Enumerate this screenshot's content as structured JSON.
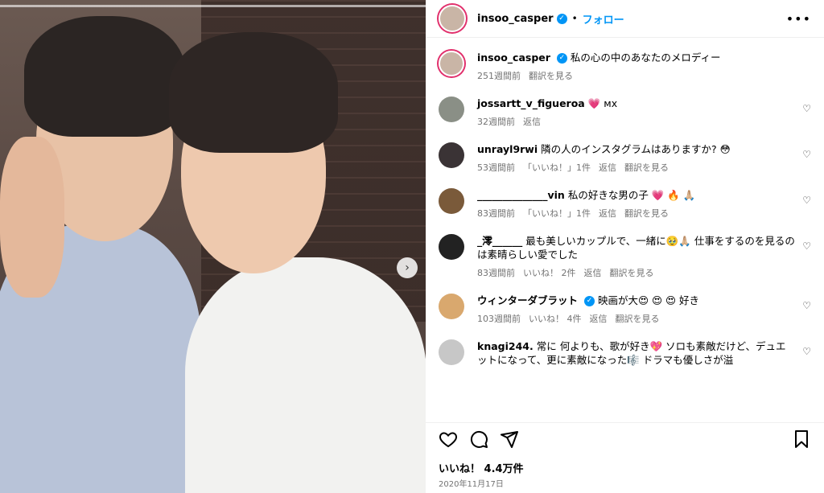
{
  "post": {
    "username": "insoo_casper",
    "follow_label": "フォロー",
    "more_label": "•••",
    "caption": "私の心の中のあなたのメロディー",
    "caption_time": "251週間前",
    "caption_translate": "翻訳を見る",
    "likes": "いいね！ 4.4万件",
    "date": "2020年11月17日"
  },
  "comments": [
    {
      "user": "jossartt_v_figueroa",
      "text": "💗 ᴍx",
      "time": "32週間前",
      "likes": "",
      "reply": "返信",
      "translate": "",
      "avatar_color": "#8a8f86",
      "verified": false
    },
    {
      "user": "unrayl9rwi",
      "text": "隣の人のインスタグラムはありますか? 😳",
      "time": "53週間前",
      "likes": "「いいね！」1件",
      "reply": "返信",
      "translate": "翻訳を見る",
      "avatar_color": "#3a3335",
      "verified": false
    },
    {
      "user": "______________vin",
      "text": "私の好きな男の子 💗 🔥 🙏🏼",
      "time": "83週間前",
      "likes": "「いいね！」1件",
      "reply": "返信",
      "translate": "翻訳を見る",
      "avatar_color": "#7a5a3a",
      "verified": false
    },
    {
      "user": "_澪______",
      "text": "最も美しいカップルで、一緒に🥹🙏🏼 仕事をするのを見るのは素晴らしい愛でした",
      "time": "83週間前",
      "likes": "いいね！ 2件",
      "reply": "返信",
      "translate": "翻訳を見る",
      "avatar_color": "#222222",
      "verified": false
    },
    {
      "user": "ウィンターダブラット",
      "text": "映画が大😍 😍 😍 好き",
      "time": "103週間前",
      "likes": "いいね！ 4件",
      "reply": "返信",
      "translate": "翻訳を見る",
      "avatar_color": "#d9a86e",
      "verified": true
    },
    {
      "user": "knagi244.",
      "text": "常に 何よりも、歌が好き💖 ソロも素敵だけど、デュエットになって、更に素敵になった🎼 ドラマも優しさが溢",
      "time": "",
      "likes": "",
      "reply": "",
      "translate": "",
      "avatar_color": "#c7c7c7",
      "verified": false
    }
  ]
}
